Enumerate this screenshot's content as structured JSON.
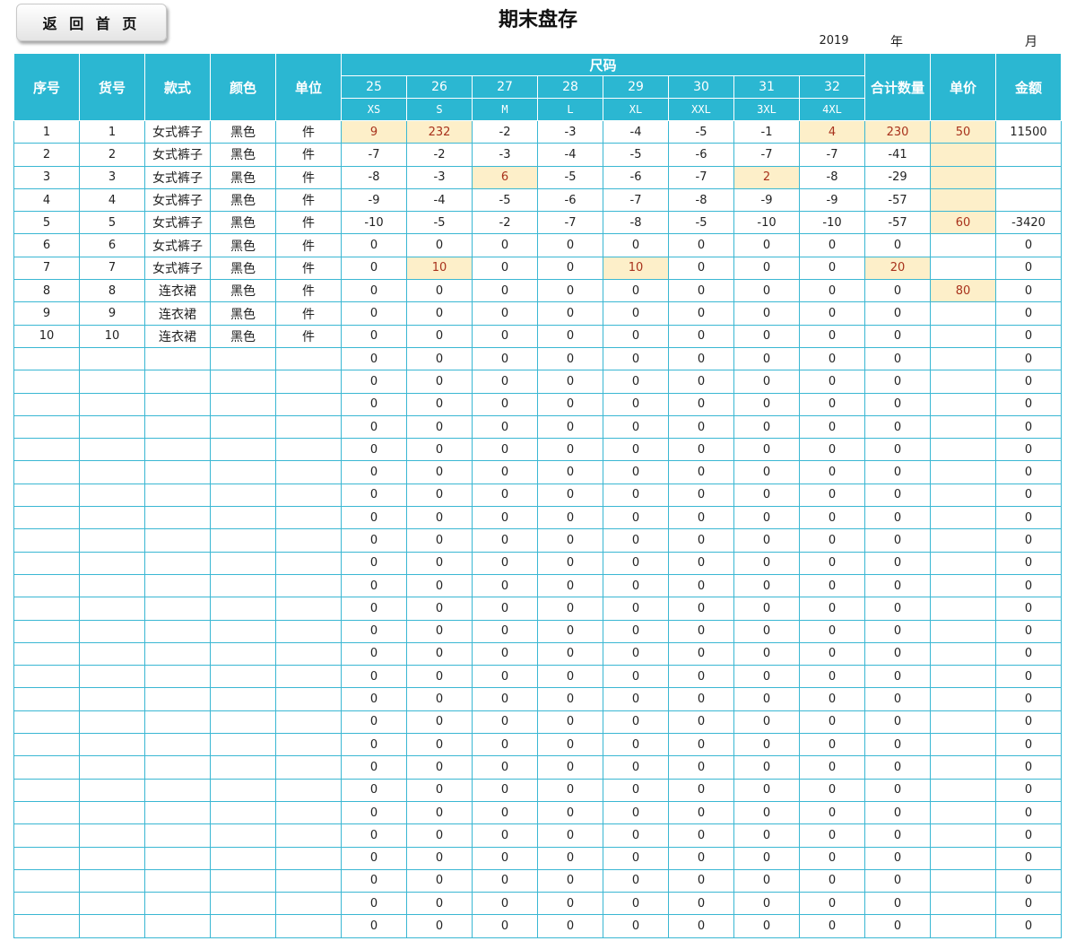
{
  "header": {
    "back_button": "返 回 首 页",
    "title": "期末盘存",
    "year": "2019",
    "year_label": "年",
    "month_label": "月"
  },
  "columns": {
    "seq": "序号",
    "item_no": "货号",
    "style": "款式",
    "color": "颜色",
    "unit": "单位",
    "size_group": "尺码",
    "total_qty": "合计数量",
    "unit_price": "单价",
    "amount": "金额",
    "sizes": [
      "25",
      "26",
      "27",
      "28",
      "29",
      "30",
      "31",
      "32"
    ],
    "size_letters": [
      "XS",
      "S",
      "M",
      "L",
      "XL",
      "XXL",
      "3XL",
      "4XL"
    ]
  },
  "colors": {
    "header_bg": "#2bb7d2",
    "border": "#3ab7d3",
    "highlight_bg": "#fdefc9",
    "highlight_text": "#a8321c"
  },
  "rows": [
    {
      "seq": "1",
      "item": "1",
      "style": "女式裤子",
      "color": "黑色",
      "unit": "件",
      "sizes": [
        "9",
        "232",
        "-2",
        "-3",
        "-4",
        "-5",
        "-1",
        "4"
      ],
      "total": "230",
      "price": "50",
      "amount": "11500",
      "hl": [
        0,
        1,
        7
      ]
    },
    {
      "seq": "2",
      "item": "2",
      "style": "女式裤子",
      "color": "黑色",
      "unit": "件",
      "sizes": [
        "-7",
        "-2",
        "-3",
        "-4",
        "-5",
        "-6",
        "-7",
        "-7"
      ],
      "total": "-41",
      "price": "",
      "amount": "",
      "hl": []
    },
    {
      "seq": "3",
      "item": "3",
      "style": "女式裤子",
      "color": "黑色",
      "unit": "件",
      "sizes": [
        "-8",
        "-3",
        "6",
        "-5",
        "-6",
        "-7",
        "2",
        "-8"
      ],
      "total": "-29",
      "price": "",
      "amount": "",
      "hl": [
        2,
        6
      ]
    },
    {
      "seq": "4",
      "item": "4",
      "style": "女式裤子",
      "color": "黑色",
      "unit": "件",
      "sizes": [
        "-9",
        "-4",
        "-5",
        "-6",
        "-7",
        "-8",
        "-9",
        "-9"
      ],
      "total": "-57",
      "price": "",
      "amount": "",
      "hl": []
    },
    {
      "seq": "5",
      "item": "5",
      "style": "女式裤子",
      "color": "黑色",
      "unit": "件",
      "sizes": [
        "-10",
        "-5",
        "-2",
        "-7",
        "-8",
        "-5",
        "-10",
        "-10"
      ],
      "total": "-57",
      "price": "60",
      "amount": "-3420",
      "hl": []
    },
    {
      "seq": "6",
      "item": "6",
      "style": "女式裤子",
      "color": "黑色",
      "unit": "件",
      "sizes": [
        "0",
        "0",
        "0",
        "0",
        "0",
        "0",
        "0",
        "0"
      ],
      "total": "0",
      "price": "",
      "amount": "0",
      "hl": []
    },
    {
      "seq": "7",
      "item": "7",
      "style": "女式裤子",
      "color": "黑色",
      "unit": "件",
      "sizes": [
        "0",
        "10",
        "0",
        "0",
        "10",
        "0",
        "0",
        "0"
      ],
      "total": "20",
      "price": "",
      "amount": "0",
      "hl": [
        1,
        4
      ]
    },
    {
      "seq": "8",
      "item": "8",
      "style": "连衣裙",
      "color": "黑色",
      "unit": "件",
      "sizes": [
        "0",
        "0",
        "0",
        "0",
        "0",
        "0",
        "0",
        "0"
      ],
      "total": "0",
      "price": "80",
      "amount": "0",
      "hl": []
    },
    {
      "seq": "9",
      "item": "9",
      "style": "连衣裙",
      "color": "黑色",
      "unit": "件",
      "sizes": [
        "0",
        "0",
        "0",
        "0",
        "0",
        "0",
        "0",
        "0"
      ],
      "total": "0",
      "price": "",
      "amount": "0",
      "hl": []
    },
    {
      "seq": "10",
      "item": "10",
      "style": "连衣裙",
      "color": "黑色",
      "unit": "件",
      "sizes": [
        "0",
        "0",
        "0",
        "0",
        "0",
        "0",
        "0",
        "0"
      ],
      "total": "0",
      "price": "",
      "amount": "0",
      "hl": []
    }
  ],
  "highlights": {
    "total_rows": [
      0,
      6
    ],
    "price_rows": [
      0,
      1,
      2,
      3,
      4,
      7
    ]
  },
  "blank_rows": {
    "count": 26,
    "size_value": "0",
    "total_value": "0",
    "amount_value": "0"
  }
}
